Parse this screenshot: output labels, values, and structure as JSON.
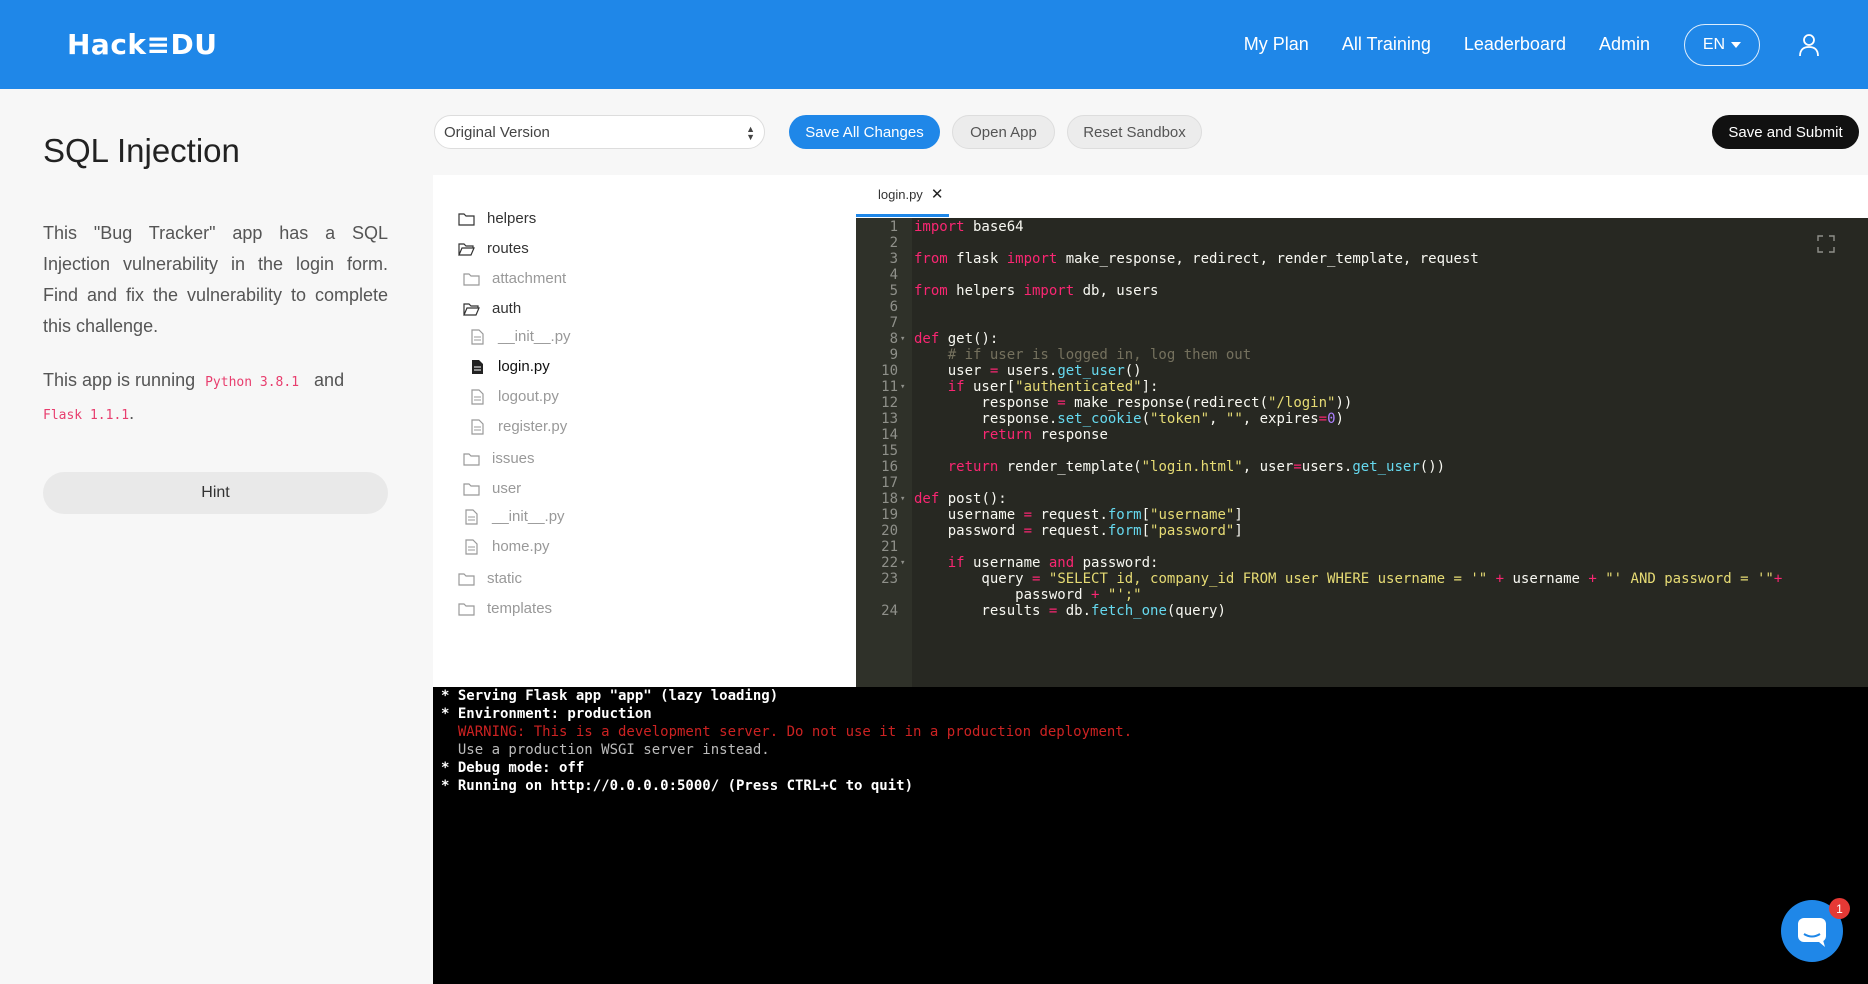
{
  "header": {
    "logo": "Hack≡DU",
    "nav": [
      "My Plan",
      "All Training",
      "Leaderboard",
      "Admin"
    ],
    "language": "EN"
  },
  "challenge": {
    "title": "SQL Injection",
    "description": "This \"Bug Tracker\" app has a SQL Injection vulnerability in the login form. Find and fix the vulnerability to complete this challenge.",
    "running_prefix": "This app is running",
    "python": "Python 3.8.1",
    "and": "and",
    "flask": "Flask 1.1.1",
    "period": ".",
    "hint_label": "Hint"
  },
  "toolbar": {
    "version_selected": "Original Version",
    "save_all": "Save All Changes",
    "open_app": "Open App",
    "reset_sandbox": "Reset Sandbox",
    "save_submit": "Save and Submit"
  },
  "filetree": [
    {
      "name": "helpers",
      "kind": "folder"
    },
    {
      "name": "routes",
      "kind": "folder-open"
    },
    {
      "name": "attachment",
      "kind": "folder"
    },
    {
      "name": "auth",
      "kind": "folder-open"
    },
    {
      "name": "__init__.py",
      "kind": "file"
    },
    {
      "name": "login.py",
      "kind": "file-active"
    },
    {
      "name": "logout.py",
      "kind": "file"
    },
    {
      "name": "register.py",
      "kind": "file"
    },
    {
      "name": "issues",
      "kind": "folder"
    },
    {
      "name": "user",
      "kind": "folder"
    },
    {
      "name": "__init__.py",
      "kind": "file"
    },
    {
      "name": "home.py",
      "kind": "file"
    },
    {
      "name": "static",
      "kind": "folder"
    },
    {
      "name": "templates",
      "kind": "folder"
    }
  ],
  "editor": {
    "tab_name": "login.py",
    "line_numbers": [
      "1",
      "2",
      "3",
      "4",
      "5",
      "6",
      "7",
      "8",
      "9",
      "10",
      "11",
      "12",
      "13",
      "14",
      "15",
      "16",
      "17",
      "18",
      "19",
      "20",
      "21",
      "22",
      "23",
      "",
      "24"
    ]
  },
  "console": {
    "lines": [
      "* Serving Flask app \"app\" (lazy loading)",
      "* Environment: production",
      "  WARNING: This is a development server. Do not use it in a production deployment.",
      "  Use a production WSGI server instead.",
      "* Debug mode: off",
      "* Running on http://0.0.0.0:5000/ (Press CTRL+C to quit)"
    ]
  },
  "chat": {
    "badge_count": "1"
  },
  "colors": {
    "brand": "#1f87e8",
    "editor_bg": "#272822",
    "keyword": "#f92672",
    "string": "#e6db74",
    "builtin": "#66d9ef",
    "comment": "#75715e",
    "warning": "#cc2222"
  }
}
